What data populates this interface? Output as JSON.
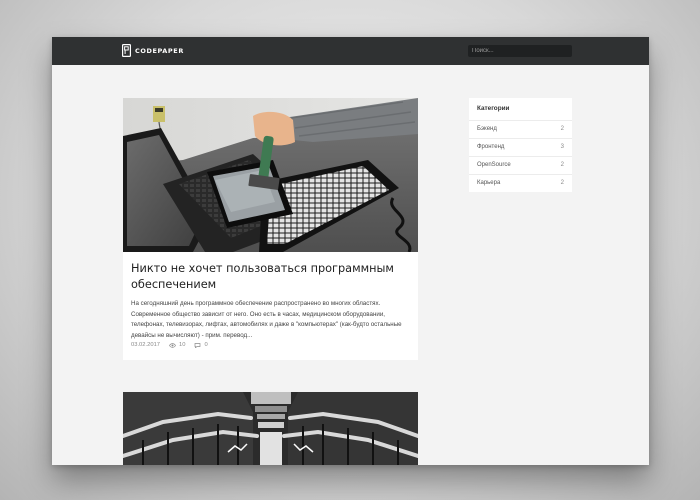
{
  "header": {
    "logo_text": "CODEPAPER",
    "search_placeholder": "Поиск..."
  },
  "posts": [
    {
      "image": "laptop-tablet-hammer-photo",
      "title": "Никто не хочет пользоваться программным обеспечением",
      "excerpt": "На сегодняшний день программное обеспечение распространено во многих областях. Современное общество зависит от него. Оно есть в часах, медицинском оборудовании, телефонах, телевизорах, лифтах, автомобилях и даже в \"компьютерах\" (как-будто остальные девайсы не вычисляют) - прим. перевод...",
      "date": "03.02.2017",
      "views": "10",
      "comments": "0"
    },
    {
      "image": "stairwell-railings-photo"
    }
  ],
  "sidebar": {
    "heading": "Категории",
    "categories": [
      {
        "name": "Бэкенд",
        "count": "2"
      },
      {
        "name": "Фронтенд",
        "count": "3"
      },
      {
        "name": "OpenSource",
        "count": "2"
      },
      {
        "name": "Карьера",
        "count": "2"
      }
    ]
  },
  "colors": {
    "navbar": "#2f3132",
    "page_background": "#f3f3f3",
    "card_background": "#ffffff"
  },
  "icons": {
    "views": "eye-icon",
    "comments": "comment-icon",
    "logo": "codepaper-logo-icon"
  }
}
